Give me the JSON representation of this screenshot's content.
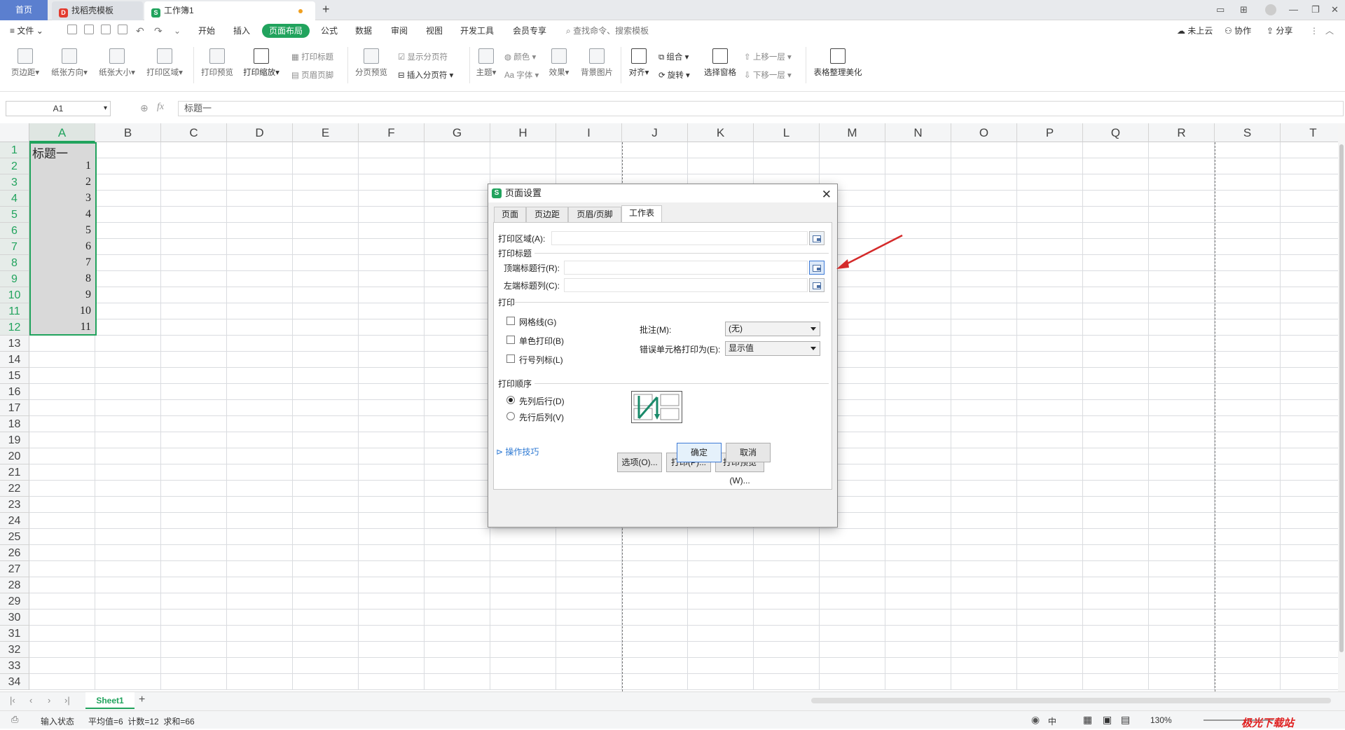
{
  "tabs": {
    "home": "首页",
    "template": "找稻壳模板",
    "workbook": "工作簿1"
  },
  "menu": {
    "file": "文件",
    "items": [
      "开始",
      "插入",
      "页面布局",
      "公式",
      "数据",
      "审阅",
      "视图",
      "开发工具",
      "会员专享"
    ],
    "active": "页面布局",
    "search": "查找命令、搜索模板",
    "right": [
      "未上云",
      "协作",
      "分享"
    ]
  },
  "ribbon": {
    "margins": "页边距",
    "orientation": "纸张方向",
    "size": "纸张大小",
    "print_area": "打印区域",
    "print_preview": "打印预览",
    "print_scale": "打印缩放",
    "print_titles": "打印标题",
    "header_footer": "页眉页脚",
    "page_break_preview": "分页预览",
    "show_page_break": "显示分页符",
    "insert_page_break": "插入分页符",
    "theme": "主题",
    "colors": "颜色",
    "fonts": "字体",
    "effects": "效果",
    "background": "背景图片",
    "align": "对齐",
    "group": "组合",
    "rotate": "旋转",
    "selection_pane": "选择窗格",
    "bring_forward": "上移一层",
    "send_backward": "下移一层",
    "table_beautify": "表格整理美化"
  },
  "formula": {
    "cell_ref": "A1",
    "fx": "fx",
    "value": "标题一"
  },
  "grid": {
    "columns": [
      "A",
      "B",
      "C",
      "D",
      "E",
      "F",
      "G",
      "H",
      "I",
      "J",
      "K",
      "L",
      "M",
      "N",
      "O",
      "P",
      "Q",
      "R",
      "S",
      "T"
    ],
    "rows": [
      "1",
      "2",
      "3",
      "4",
      "5",
      "6",
      "7",
      "8",
      "9",
      "10",
      "11",
      "12",
      "13",
      "14",
      "15",
      "16",
      "17",
      "18",
      "19",
      "20",
      "21",
      "22",
      "23",
      "24",
      "25",
      "26",
      "27",
      "28",
      "29",
      "30",
      "31",
      "32",
      "33",
      "34"
    ],
    "a_values": [
      "标题一",
      "1",
      "2",
      "3",
      "4",
      "5",
      "6",
      "7",
      "8",
      "9",
      "10",
      "11"
    ]
  },
  "dialog": {
    "title": "页面设置",
    "tabs": [
      "页面",
      "页边距",
      "页眉/页脚",
      "工作表"
    ],
    "active_tab": "工作表",
    "print_area_label": "打印区域(A):",
    "print_titles_section": "打印标题",
    "top_rows_label": "顶端标题行(R):",
    "left_cols_label": "左端标题列(C):",
    "print_section": "打印",
    "gridlines": "网格线(G)",
    "mono": "单色打印(B)",
    "headings": "行号列标(L)",
    "comments_label": "批注(M):",
    "comments_value": "(无)",
    "errors_label": "错误单元格打印为(E):",
    "errors_value": "显示值",
    "order_section": "打印顺序",
    "down_then_over": "先列后行(D)",
    "over_then_down": "先行后列(V)",
    "options_btn": "选项(O)...",
    "print_btn": "打印(P)...",
    "preview_btn": "打印预览(W)...",
    "tips": "操作技巧",
    "ok": "确定",
    "cancel": "取消"
  },
  "sheet": {
    "tab": "Sheet1"
  },
  "status": {
    "mode": "输入状态",
    "stats": "平均值=6  计数=12  求和=66",
    "ime": "中",
    "zoom": "130%"
  },
  "watermark": "极光下载站"
}
